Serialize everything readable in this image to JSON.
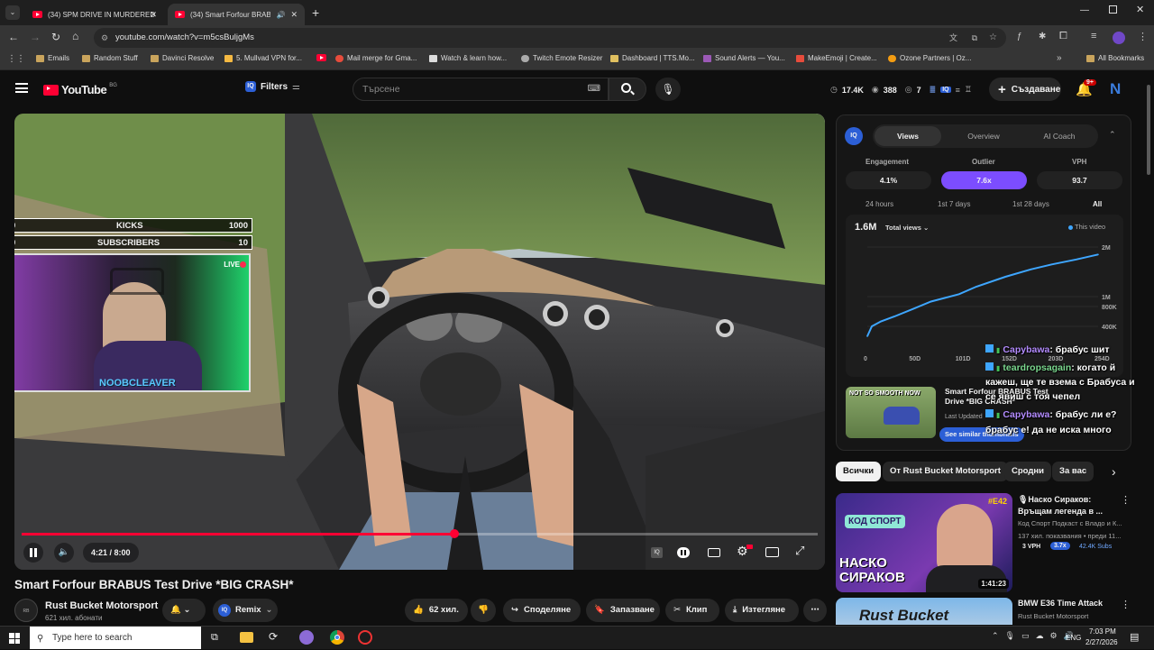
{
  "browser": {
    "tabs": [
      {
        "title": "(34) SPM DRIVE IN MURDERED"
      },
      {
        "title": "(34) Smart Forfour BRABUS"
      }
    ],
    "url": "youtube.com/watch?v=m5csBuljgMs",
    "bookmarks": [
      "Emails",
      "Random Stuff",
      "Davinci Resolve",
      "5. Mullvad VPN for...",
      "Mail merge for Gma...",
      "Watch & learn how...",
      "Twitch Emote Resizer",
      "Dashboard | TTS.Mo...",
      "Sound Alerts — You...",
      "MakeEmoji | Create...",
      "Ozone Partners | Oz...",
      "All Bookmarks"
    ]
  },
  "youtube": {
    "logo": "YouTube",
    "country": "BG",
    "filters_label": "Filters",
    "search_placeholder": "Търсене",
    "stats": {
      "views": "17.4K",
      "eye": "388",
      "online": "7"
    },
    "create_label": "Създаване",
    "notif_badge": "9+",
    "avatar_letter": "N"
  },
  "overlay": {
    "kicks": {
      "value": "0",
      "label": "KICKS",
      "goal": "1000"
    },
    "subs": {
      "value": "0",
      "label": "SUBSCRIBERS",
      "goal": "10"
    },
    "live": "LIVE",
    "streamer": "NOOBCLEAVER"
  },
  "player": {
    "time": "4:21 / 8:00",
    "progress": 0.544
  },
  "video": {
    "title": "Smart Forfour BRABUS Test Drive *BIG CRASH*",
    "channel": "Rust Bucket Motorsport",
    "subs": "621 хил. абонати",
    "remix": "Remix",
    "likes": "62 хил.",
    "share": "Споделяне",
    "save": "Запазване",
    "clip": "Клип",
    "download": "Изтегляне"
  },
  "iq": {
    "tabs": [
      "Views",
      "Overview",
      "AI Coach"
    ],
    "metrics": [
      {
        "label": "Engagement",
        "value": "4.1%"
      },
      {
        "label": "Outlier",
        "value": "7.6x"
      },
      {
        "label": "VPH",
        "value": "93.7"
      }
    ],
    "ranges": [
      "24 hours",
      "1st 7 days",
      "1st 28 days",
      "All"
    ],
    "total": "1.6M",
    "total_label": "Total views",
    "legend": "This video",
    "yticks": [
      "2M",
      "1M",
      "800K",
      "400K"
    ],
    "xticks": [
      "0",
      "50D",
      "101D",
      "152D",
      "203D",
      "254D"
    ],
    "similar": {
      "thumb_text": "NOT SO SMOOTH NOW",
      "title": "Smart Forfour BRABUS Test Drive *BIG CRASH*",
      "updated": "Last Updated",
      "button": "See similar thumbnails"
    }
  },
  "chat": [
    {
      "user": "Capybawa",
      "msg": ": брабус шит",
      "color": "#b48cff"
    },
    {
      "user": "teardropsagain",
      "msg": ": когато й",
      "cont": "кажеш, ще те взема с Брабуса и",
      "cont2": "се явиш с тоя чепел",
      "color": "#7bd88f"
    },
    {
      "user": "Capybawa",
      "msg": ": брабус ли е?",
      "cont": "брабус е! да не иска много",
      "color": "#b48cff"
    }
  ],
  "chips": [
    "Всички",
    "От Rust Bucket Motorsport",
    "Сродни",
    "За вас"
  ],
  "related": [
    {
      "title": "🎙Наско Сираков: Връщам легенда в ...",
      "channel": "Код Спорт Подкаст с Владо и К...",
      "meta": "137 хил. показвания • преди 11...",
      "vph": "3 VPH",
      "mult": "3.7x",
      "subs": "42.4K Subs",
      "duration": "1:41:23",
      "thumb_tag": "#E42",
      "thumb_name": "НАСКО СИРАКОВ",
      "thumb_brand": "КОД СПОРТ"
    },
    {
      "title": "BMW E36 Time Attack",
      "channel": "Rust Bucket Motorsport",
      "thumb_name": "Rust Bucket"
    }
  ],
  "taskbar": {
    "search": "Type here to search",
    "lang": "ENG",
    "time": "7:03 PM",
    "date": "2/27/2026"
  },
  "chart_data": {
    "type": "line",
    "x": [
      0,
      5,
      15,
      30,
      50,
      70,
      101,
      120,
      152,
      180,
      203,
      230,
      254
    ],
    "series": [
      {
        "name": "This video",
        "values": [
          0.2,
          0.4,
          0.5,
          0.6,
          0.75,
          0.9,
          1.05,
          1.2,
          1.4,
          1.55,
          1.65,
          1.75,
          1.85
        ]
      }
    ],
    "xticks": [
      "0",
      "50D",
      "101D",
      "152D",
      "203D",
      "254D"
    ],
    "yticks": [
      "400K",
      "800K",
      "1M",
      "2M"
    ],
    "legend": "top-right"
  },
  "colors": {
    "accent": "#7c4dff",
    "youtube_red": "#ff0033",
    "progress": "#ff0033",
    "chart_line": "#3ea6ff"
  }
}
